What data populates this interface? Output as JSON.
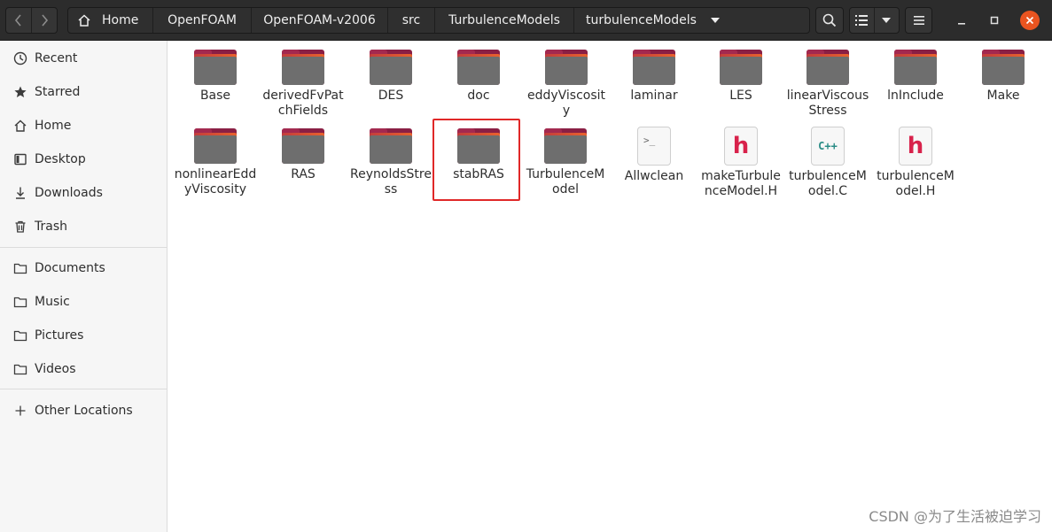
{
  "header": {
    "breadcrumbs": [
      "Home",
      "OpenFOAM",
      "OpenFOAM-v2006",
      "src",
      "TurbulenceModels",
      "turbulenceModels"
    ]
  },
  "sidebar": {
    "items": [
      {
        "label": "Recent",
        "icon": "clock-icon"
      },
      {
        "label": "Starred",
        "icon": "star-icon"
      },
      {
        "label": "Home",
        "icon": "home-icon"
      },
      {
        "label": "Desktop",
        "icon": "desktop-icon"
      },
      {
        "label": "Downloads",
        "icon": "download-icon"
      },
      {
        "label": "Trash",
        "icon": "trash-icon"
      },
      {
        "label": "Documents",
        "icon": "folder-icon"
      },
      {
        "label": "Music",
        "icon": "folder-icon"
      },
      {
        "label": "Pictures",
        "icon": "folder-icon"
      },
      {
        "label": "Videos",
        "icon": "folder-icon"
      },
      {
        "label": "Other Locations",
        "icon": "plus-icon"
      }
    ]
  },
  "files": [
    {
      "name": "Base",
      "type": "folder"
    },
    {
      "name": "derivedFvPatchFields",
      "type": "folder"
    },
    {
      "name": "DES",
      "type": "folder"
    },
    {
      "name": "doc",
      "type": "folder"
    },
    {
      "name": "eddyViscosity",
      "type": "folder"
    },
    {
      "name": "laminar",
      "type": "folder"
    },
    {
      "name": "LES",
      "type": "folder"
    },
    {
      "name": "linearViscousStress",
      "type": "folder"
    },
    {
      "name": "lnInclude",
      "type": "folder"
    },
    {
      "name": "Make",
      "type": "folder"
    },
    {
      "name": "nonlinearEddyViscosity",
      "type": "folder"
    },
    {
      "name": "RAS",
      "type": "folder"
    },
    {
      "name": "ReynoldsStress",
      "type": "folder"
    },
    {
      "name": "stabRAS",
      "type": "folder",
      "highlighted": true
    },
    {
      "name": "TurbulenceModel",
      "type": "folder"
    },
    {
      "name": "Allwclean",
      "type": "script"
    },
    {
      "name": "makeTurbulenceModel.H",
      "type": "header"
    },
    {
      "name": "turbulenceModel.C",
      "type": "cpp"
    },
    {
      "name": "turbulenceModel.H",
      "type": "header"
    }
  ],
  "watermark": "CSDN @为了生活被迫学习",
  "colors": {
    "accent": "#e95420",
    "highlight_border": "#e02828",
    "folder_body": "#6e6e6e",
    "folder_back": "#8a1f44"
  }
}
